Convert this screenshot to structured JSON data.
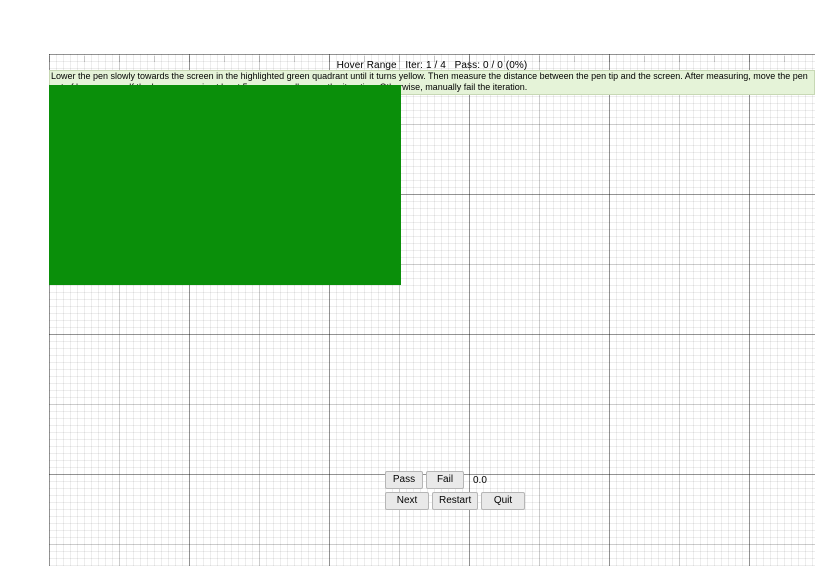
{
  "header": {
    "title": "Hover Range",
    "iter_label": "Iter:",
    "iter_value": "1 / 4",
    "pass_label": "Pass:",
    "pass_value": "0 / 0 (0%)"
  },
  "instruction_text": "Lower the pen slowly towards the screen in the highlighted green quadrant until it turns yellow. Then measure the distance between the pen tip and the screen. After measuring, move the pen out of hover range. If the hover range is at least 5mm, manually pass the iteration. Otherwise, manually fail the iteration.",
  "quadrant": {
    "state": "green",
    "color": "#0a8f0a"
  },
  "controls": {
    "pass_label": "Pass",
    "fail_label": "Fail",
    "value_text": "0.0",
    "next_label": "Next",
    "restart_label": "Restart",
    "quit_label": "Quit"
  }
}
